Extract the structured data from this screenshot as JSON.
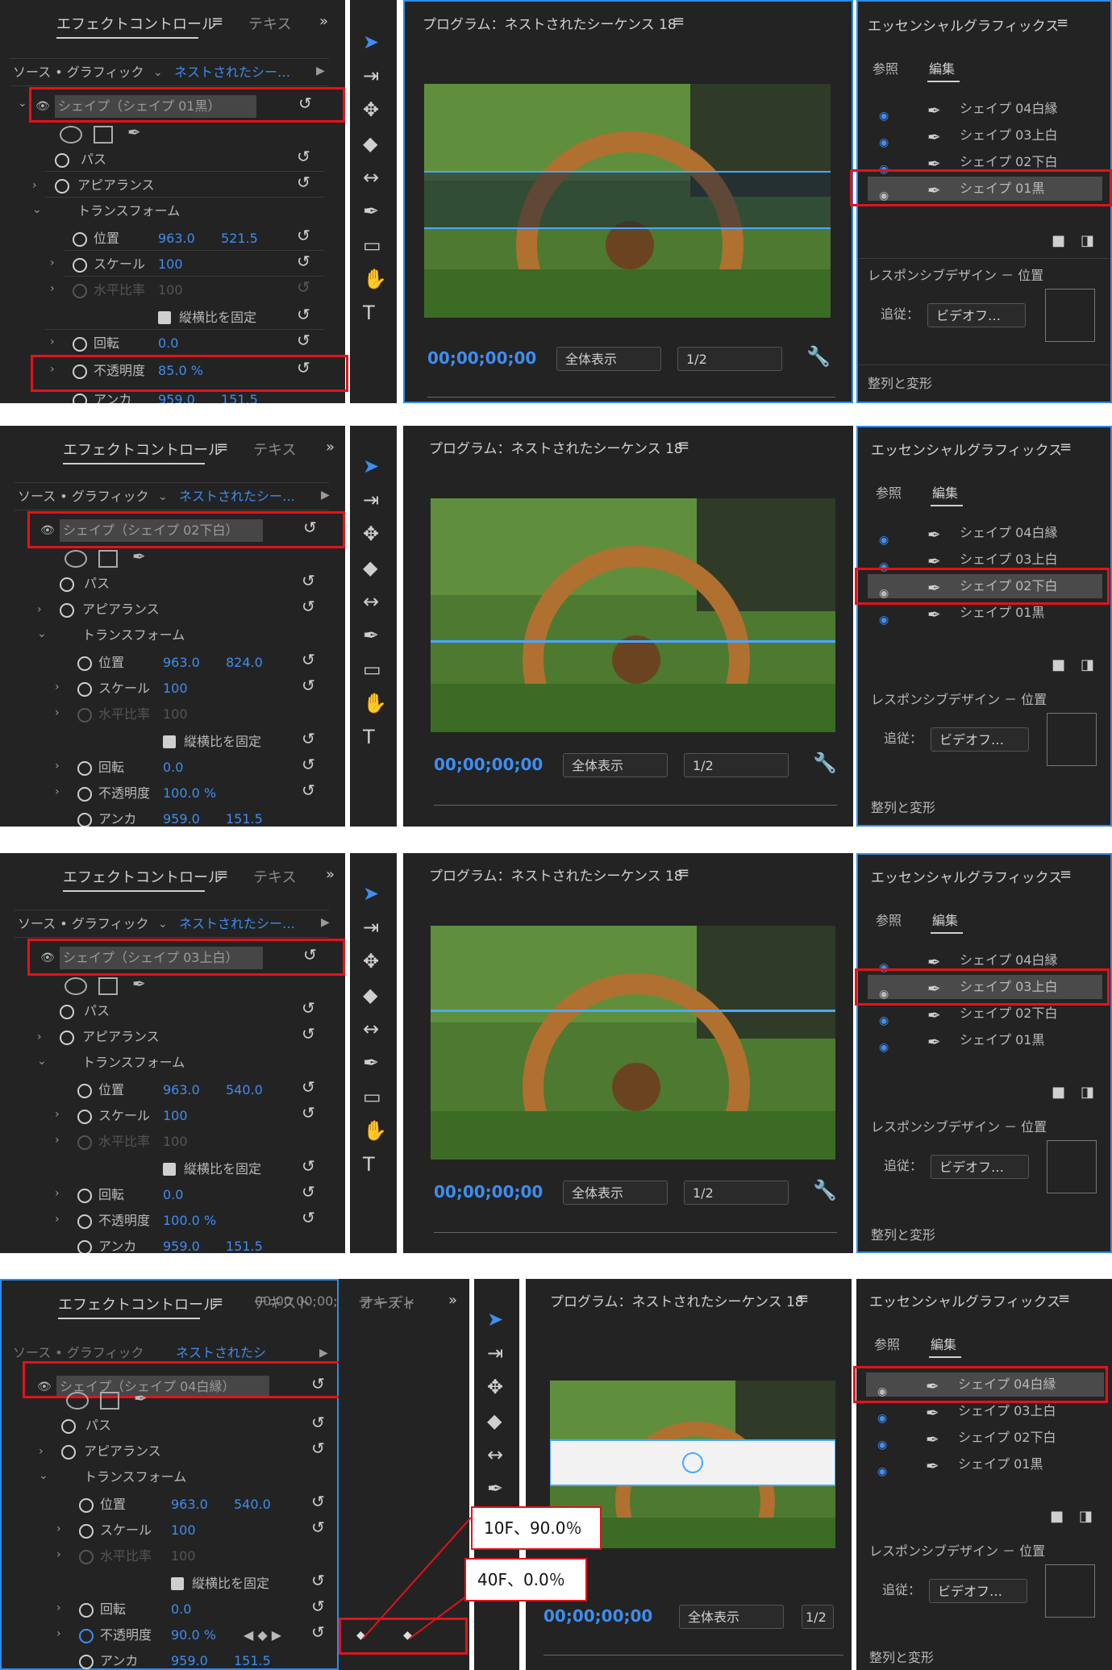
{
  "tabs": {
    "effect_control": "エフェクトコントロール",
    "text": "テキス",
    "text_full": "テキスト",
    "audio": "オーディ",
    "more": "»",
    "menu": "≡"
  },
  "program": {
    "title": "プログラム：ネストされたシーケンス 18",
    "timecode": "00;00;00;00",
    "zoom": "全体表示",
    "resolution": "1/2",
    "resolution_short": "1/2"
  },
  "essential": {
    "title": "エッセンシャルグラフィックス",
    "tab_browse": "参照",
    "tab_edit": "編集",
    "responsive": "レスポンシブデザイン － 位置",
    "follow_label": "追従：",
    "follow_value": "ビデオフ…",
    "align": "整列と変形",
    "layers": [
      "シェイプ 04白縁",
      "シェイプ 03上白",
      "シェイプ 02下白",
      "シェイプ 01黒"
    ]
  },
  "effect": {
    "source": "ソース • グラフィック",
    "target": "ネストされたシー…",
    "target_short": "ネストされたシ",
    "timeline_tc": "00;00 00;00;0",
    "path": "パス",
    "appearance": "アピアランス",
    "transform": "トランスフォーム",
    "position": "位置",
    "scale": "スケール",
    "scale_width": "水平比率",
    "lock_ratio": "縦横比を固定",
    "rotation": "回転",
    "opacity": "不透明度",
    "anchor": "アンカ"
  },
  "screens": [
    {
      "shape": "シェイプ（シェイプ 01黒）",
      "pos_x": "963.0",
      "pos_y": "521.5",
      "scale": "100",
      "scale_w": "100",
      "rotation": "0.0",
      "opacity": "85.0 %",
      "anchor_x": "959.0",
      "anchor_y": "151.5",
      "selected": 3
    },
    {
      "shape": "シェイプ（シェイプ 02下白）",
      "pos_x": "963.0",
      "pos_y": "824.0",
      "scale": "100",
      "scale_w": "100",
      "rotation": "0.0",
      "opacity": "100.0 %",
      "anchor_x": "959.0",
      "anchor_y": "151.5",
      "selected": 2
    },
    {
      "shape": "シェイプ（シェイプ 03上白）",
      "pos_x": "963.0",
      "pos_y": "540.0",
      "scale": "100",
      "scale_w": "100",
      "rotation": "0.0",
      "opacity": "100.0 %",
      "anchor_x": "959.0",
      "anchor_y": "151.5",
      "selected": 1
    },
    {
      "shape": "シェイプ（シェイプ 04白縁）",
      "pos_x": "963.0",
      "pos_y": "540.0",
      "scale": "100",
      "scale_w": "100",
      "rotation": "0.0",
      "opacity": "90.0 %",
      "anchor_x": "959.0",
      "anchor_y": "151.5",
      "selected": 0
    }
  ],
  "callouts": {
    "first": "10F、90.0％",
    "second": "40F、0.0％"
  },
  "colors": {
    "panel": "#232323",
    "accent": "#2d8ceb",
    "highlight": "#e3121a",
    "value": "#3f8df0"
  }
}
